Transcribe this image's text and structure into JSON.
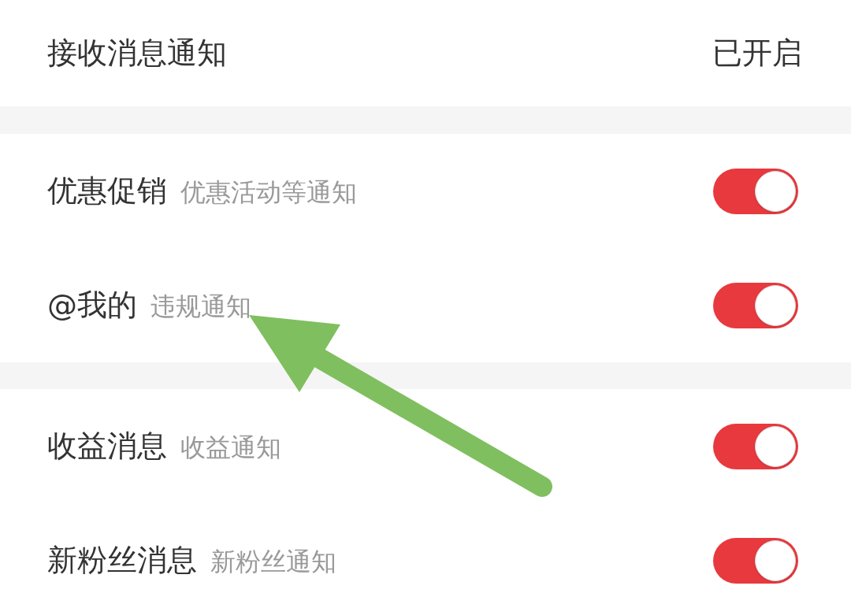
{
  "header": {
    "label": "接收消息通知",
    "status": "已开启"
  },
  "groups": [
    {
      "items": [
        {
          "title": "优惠促销",
          "subtitle": "优惠活动等通知",
          "on": true
        },
        {
          "title": "@我的",
          "subtitle": "违规通知",
          "on": true
        }
      ]
    },
    {
      "items": [
        {
          "title": "收益消息",
          "subtitle": "收益通知",
          "on": true
        },
        {
          "title": "新粉丝消息",
          "subtitle": "新粉丝通知",
          "on": true
        }
      ]
    }
  ]
}
